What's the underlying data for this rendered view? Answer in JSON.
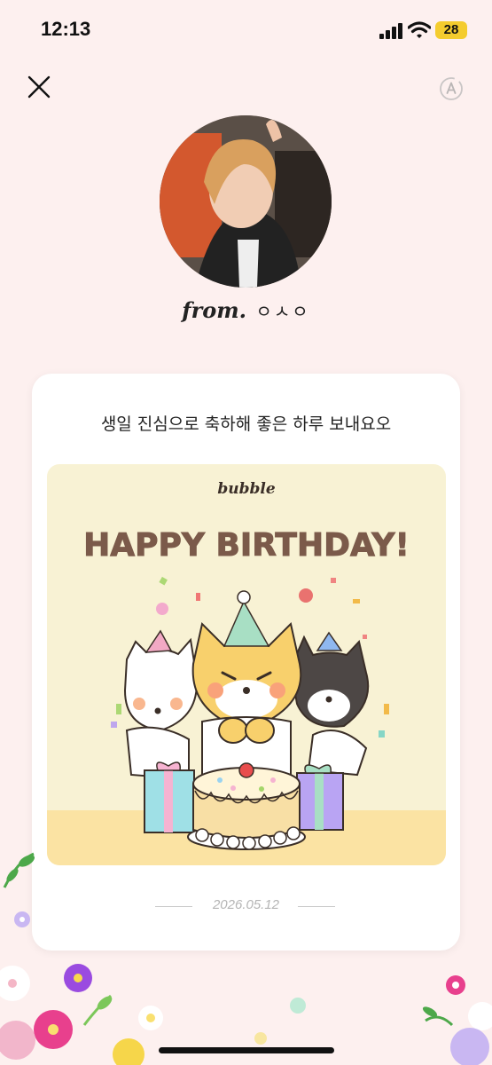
{
  "status_bar": {
    "time": "12:13",
    "battery": "28"
  },
  "header": {
    "close_icon": "close-icon",
    "translate_icon": "translate-icon"
  },
  "sender": {
    "from_label": "from.",
    "name": "ㅇㅅㅇ"
  },
  "letter": {
    "message": "생일 진심으로 축하해 좋은 하루 보내요오",
    "card_logo": "bubble",
    "card_title": "HAPPY BIRTHDAY!",
    "date": "2026.05.12"
  },
  "colors": {
    "background": "#fdf0ef",
    "card_bg": "#f8f2d4",
    "title_brown": "#7b5a4a",
    "battery_yellow": "#f4cc2e"
  }
}
